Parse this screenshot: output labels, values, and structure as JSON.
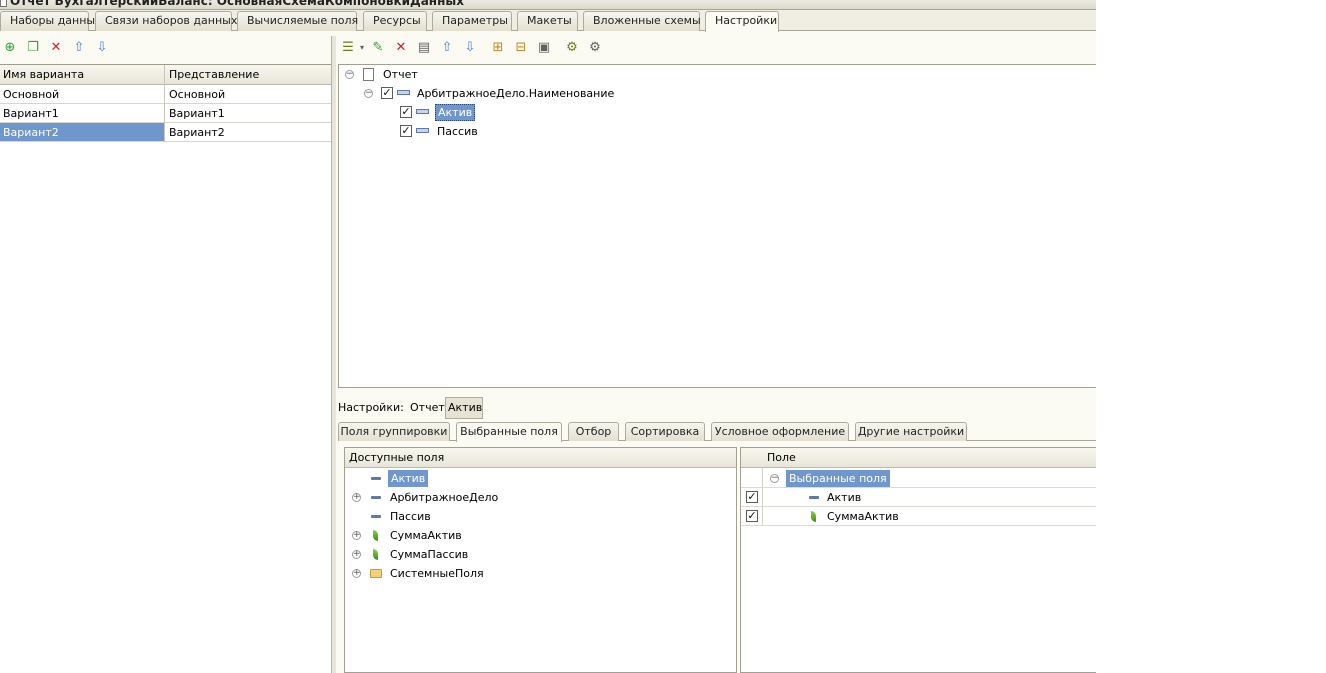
{
  "window": {
    "title": "Отчет БухгалтерскийБаланс: ОсновнаяСхемаКомпоновкиДанных"
  },
  "main_tabs": [
    {
      "label": "Наборы данных"
    },
    {
      "label": "Связи наборов данных"
    },
    {
      "label": "Вычисляемые поля"
    },
    {
      "label": "Ресурсы"
    },
    {
      "label": "Параметры"
    },
    {
      "label": "Макеты"
    },
    {
      "label": "Вложенные схемы"
    },
    {
      "label": "Настройки",
      "active": true
    }
  ],
  "left_toolbar": [
    "add-icon",
    "copy-icon",
    "delete-icon",
    "move-up-icon",
    "move-down-icon"
  ],
  "variants": {
    "columns": [
      "Имя варианта",
      "Представление"
    ],
    "rows": [
      {
        "name": "Основной",
        "presentation": "Основной"
      },
      {
        "name": "Вариант1",
        "presentation": "Вариант1"
      },
      {
        "name": "Вариант2",
        "presentation": "Вариант2",
        "selected": true
      }
    ]
  },
  "structure_toolbar": [
    "add-dropdown-icon",
    "edit-icon",
    "delete-icon",
    "properties-icon",
    "move-up-icon",
    "move-down-icon",
    "group-icon",
    "ungroup-icon",
    "move-out-icon",
    "current-settings-icon",
    "preview-icon"
  ],
  "structure_tree": {
    "root": "Отчет",
    "group": "АрбитражноеДело.Наименование",
    "children": [
      {
        "label": "Актив",
        "checked": true,
        "selected": true
      },
      {
        "label": "Пассив",
        "checked": true
      }
    ]
  },
  "settings_bar": {
    "label": "Настройки:",
    "report": "Отчет",
    "current": "Актив"
  },
  "settings_tabs": [
    {
      "label": "Поля группировки"
    },
    {
      "label": "Выбранные поля",
      "active": true
    },
    {
      "label": "Отбор"
    },
    {
      "label": "Сортировка"
    },
    {
      "label": "Условное оформление"
    },
    {
      "label": "Другие настройки"
    }
  ],
  "available_fields": {
    "header": "Доступные поля",
    "items": [
      {
        "label": "Актив",
        "icon": "field",
        "selected": true
      },
      {
        "label": "АрбитражноеДело",
        "icon": "field",
        "expandable": true
      },
      {
        "label": "Пассив",
        "icon": "field"
      },
      {
        "label": "СуммаАктив",
        "icon": "resource",
        "expandable": true
      },
      {
        "label": "СуммаПассив",
        "icon": "resource",
        "expandable": true
      },
      {
        "label": "СистемныеПоля",
        "icon": "folder",
        "expandable": true
      }
    ]
  },
  "selected_fields": {
    "header": "Поле",
    "group": "Выбранные поля",
    "items": [
      {
        "label": "Актив",
        "checked": true,
        "icon": "field"
      },
      {
        "label": "СуммаАктив",
        "checked": true,
        "icon": "resource"
      }
    ]
  },
  "symbols": {
    "expand": "+",
    "collapse": "−",
    "check": "✓"
  }
}
